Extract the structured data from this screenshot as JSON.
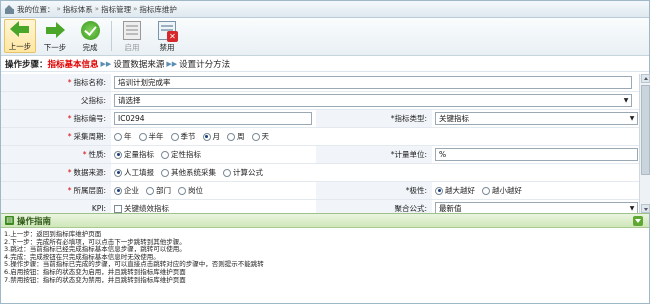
{
  "breadcrumb": {
    "prefix": "我的位置：",
    "items": [
      "指标体系",
      "指标管理",
      "指标库维护"
    ]
  },
  "toolbar": {
    "prev": "上一步",
    "next": "下一步",
    "finish": "完成",
    "enable": "启用",
    "disable": "禁用"
  },
  "steps": {
    "title": "操作步骤：",
    "current": "指标基本信息",
    "step2": "设置数据来源",
    "step3": "设置计分方法"
  },
  "form": {
    "name_label": "指标名称:",
    "name_value": "培训计划完成率",
    "parent_label": "父指标:",
    "parent_value": "请选择",
    "code_label": "指标编号:",
    "code_value": "IC0294",
    "type_label": "指标类型:",
    "type_value": "关键指标",
    "period_label": "采集周期:",
    "period_options": [
      "年",
      "半年",
      "季节",
      "月",
      "周",
      "天"
    ],
    "period_selected": 3,
    "nature_label": "性质:",
    "nature_options": [
      "定量指标",
      "定性指标"
    ],
    "unit_label": "计量单位:",
    "unit_value": "%",
    "source_label": "数据来源:",
    "source_options": [
      "人工填报",
      "其他系统采集",
      "计算公式"
    ],
    "level_label": "所属层面:",
    "level_options": [
      "企业",
      "部门",
      "岗位"
    ],
    "polarity_label": "极性:",
    "polarity_options": [
      "越大越好",
      "越小越好"
    ],
    "kpi_label": "KPI:",
    "kpi_text": "关键绩效指标",
    "formula_label": "聚合公式:",
    "formula_value": "最新值"
  },
  "guide": {
    "title": "操作指南",
    "lines": [
      "1.上一步：返回到指标库维护页面",
      "2.下一步：完成所有必填项，可以点击下一步跳转到其他步骤。",
      "3.跳过：当前指标已经完成指标基本信息步骤，跳转可以使用。",
      "4.完成：完成按钮在只完成指标基本信息时无效使用。",
      "5.操作步骤：当前指标已完成的步骤，可以直接点击跳转对应的步骤中，否则提示不能跳转",
      "6.启用按钮：指标的状态变为启用，并且跳转到指标库维护页面",
      "7.禁用按钮：指标的状态变为禁用，并且跳转到指标库维护页面"
    ]
  }
}
